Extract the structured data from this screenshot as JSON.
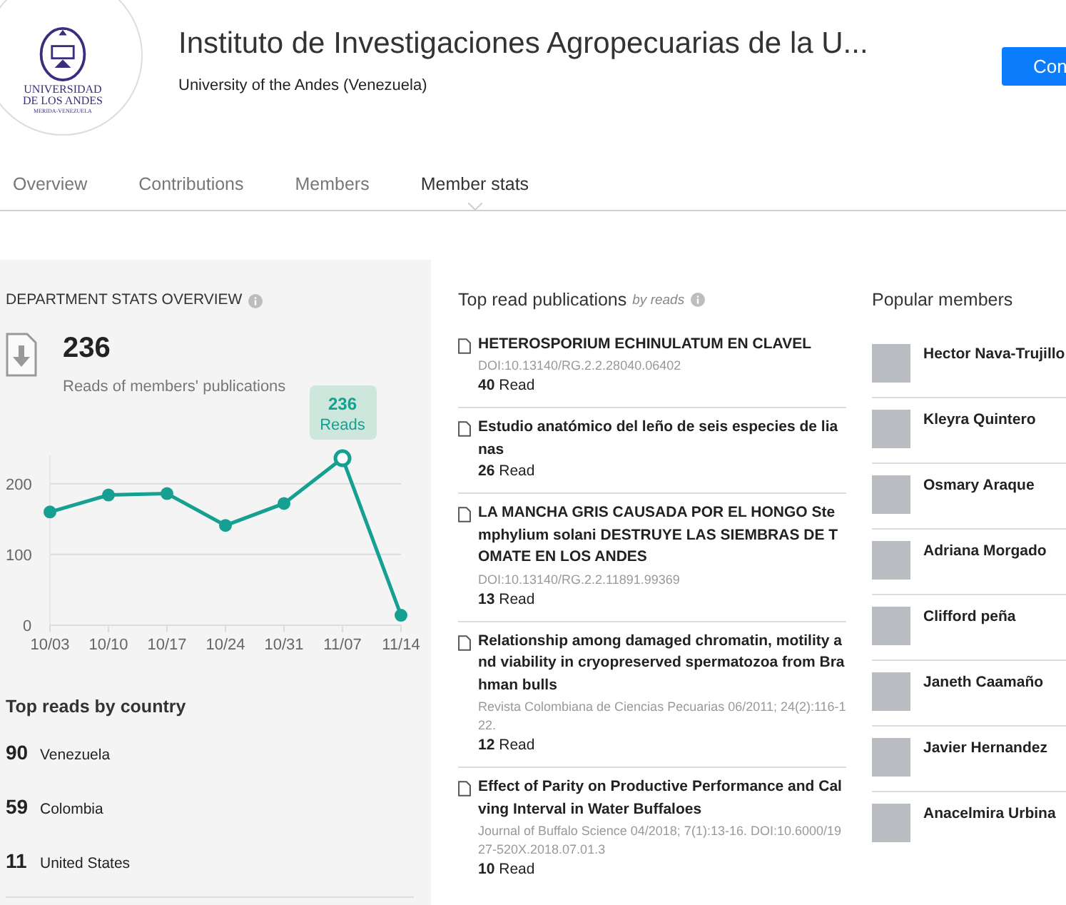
{
  "header": {
    "logo_lines": [
      "UNIVERSIDAD",
      "DE LOS ANDES",
      "MERIDA-VENEZUELA"
    ],
    "title": "Instituto de Investigaciones Agropecuarias de la U...",
    "subtitle": "University of the Andes (Venezuela)",
    "button": "Con"
  },
  "tabs": [
    {
      "label": "Overview",
      "selected": false
    },
    {
      "label": "Contributions",
      "selected": false
    },
    {
      "label": "Members",
      "selected": false
    },
    {
      "label": "Member stats",
      "selected": true
    }
  ],
  "stats": {
    "heading": "DEPARTMENT STATS OVERVIEW",
    "total": "236",
    "total_label": "Reads of members' publications",
    "chart_tooltip": {
      "value": "236"
    },
    "chart_data": {
      "type": "line",
      "categories": [
        "10/03",
        "10/10",
        "10/17",
        "10/24",
        "10/31",
        "11/07",
        "11/14"
      ],
      "series": [
        {
          "name": "Reads",
          "color": "#16a092",
          "values": [
            160,
            184,
            186,
            141,
            172,
            236,
            14
          ],
          "marker": "circle"
        }
      ],
      "ylim": [
        0,
        240
      ],
      "yticks": [
        0,
        100,
        200
      ]
    },
    "countries_heading": "Top reads by country",
    "countries": [
      {
        "count": "90",
        "name": "Venezuela"
      },
      {
        "count": "59",
        "name": "Colombia"
      },
      {
        "count": "11",
        "name": "United States"
      }
    ]
  },
  "publications": {
    "heading": "Top read publications",
    "sort_label": "by reads",
    "items": [
      {
        "title": "HETEROSPORIUM ECHINULATUM EN CLAVEL",
        "meta": "DOI:10.13140/RG.2.2.28040.06402",
        "reads": "40",
        "reads_label": "Read"
      },
      {
        "title": "Estudio anatómico del leño de seis especies de lianas",
        "reads": "26",
        "reads_label": "Read"
      },
      {
        "title": "LA MANCHA GRIS CAUSADA POR EL HONGO Stemphylium solani DESTRUYE LAS SIEMBRAS DE TOMATE EN LOS ANDES",
        "meta": "DOI:10.13140/RG.2.2.11891.99369",
        "reads": "13",
        "reads_label": "Read"
      },
      {
        "title": "Relationship among damaged chromatin, motility and viability in cryopreserved spermatozoa from Brahman bulls",
        "meta": "Revista Colombiana de Ciencias Pecuarias 06/2011; 24(2):116-122.",
        "reads": "12",
        "reads_label": "Read"
      },
      {
        "title": "Effect of Parity on Productive Performance and Calving Interval in Water Buffaloes",
        "meta": "Journal of Buffalo Science 04/2018; 7(1):13-16. DOI:10.6000/1927-520X.2018.07.01.3",
        "reads": "10",
        "reads_label": "Read"
      }
    ]
  },
  "members": {
    "heading": "Popular members",
    "items": [
      {
        "name": "Hector Nava-Trujillo"
      },
      {
        "name": "Kleyra Quintero"
      },
      {
        "name": "Osmary Araque"
      },
      {
        "name": "Adriana Morgado"
      },
      {
        "name": "Clifford peña"
      },
      {
        "name": "Janeth Caamaño"
      },
      {
        "name": "Javier Hernandez"
      },
      {
        "name": "Anacelmira Urbina"
      }
    ]
  }
}
